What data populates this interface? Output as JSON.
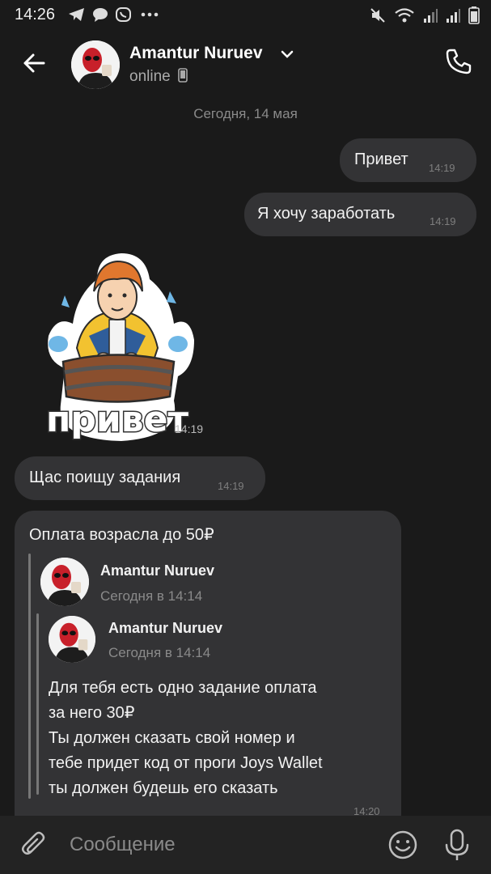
{
  "status_bar": {
    "time": "14:26"
  },
  "header": {
    "contact_name": "Amantur Nuruev",
    "status": "online"
  },
  "date_divider": "Сегодня, 14 мая",
  "messages": [
    {
      "text": "Привет",
      "time": "14:19",
      "side": "outgoing"
    },
    {
      "text": "Я хочу заработать",
      "time": "14:19",
      "side": "outgoing"
    },
    {
      "sticker_caption": "привет",
      "time": "14:19",
      "side": "incoming"
    },
    {
      "text": "Щас поищу задания",
      "time": "14:19",
      "side": "incoming"
    },
    {
      "text": "Оплата возрасла до 50₽",
      "time": "14:20",
      "side": "incoming",
      "forward_outer": {
        "author": "Amantur Nuruev",
        "date": "Сегодня в 14:14"
      },
      "forward_inner": {
        "author": "Amantur Nuruev",
        "date": "Сегодня в 14:14",
        "lines": [
          "Для тебя есть одно задание оплата",
          "за него 30₽",
          "Ты должен сказать свой номер и",
          "тебе придет код от проги Joys Wallet",
          "ты должен будешь его сказать"
        ]
      }
    }
  ],
  "composer": {
    "placeholder": "Сообщение"
  },
  "colors": {
    "background": "#1a1a1a",
    "bubble": "#333335",
    "muted": "#8a8a8a"
  }
}
